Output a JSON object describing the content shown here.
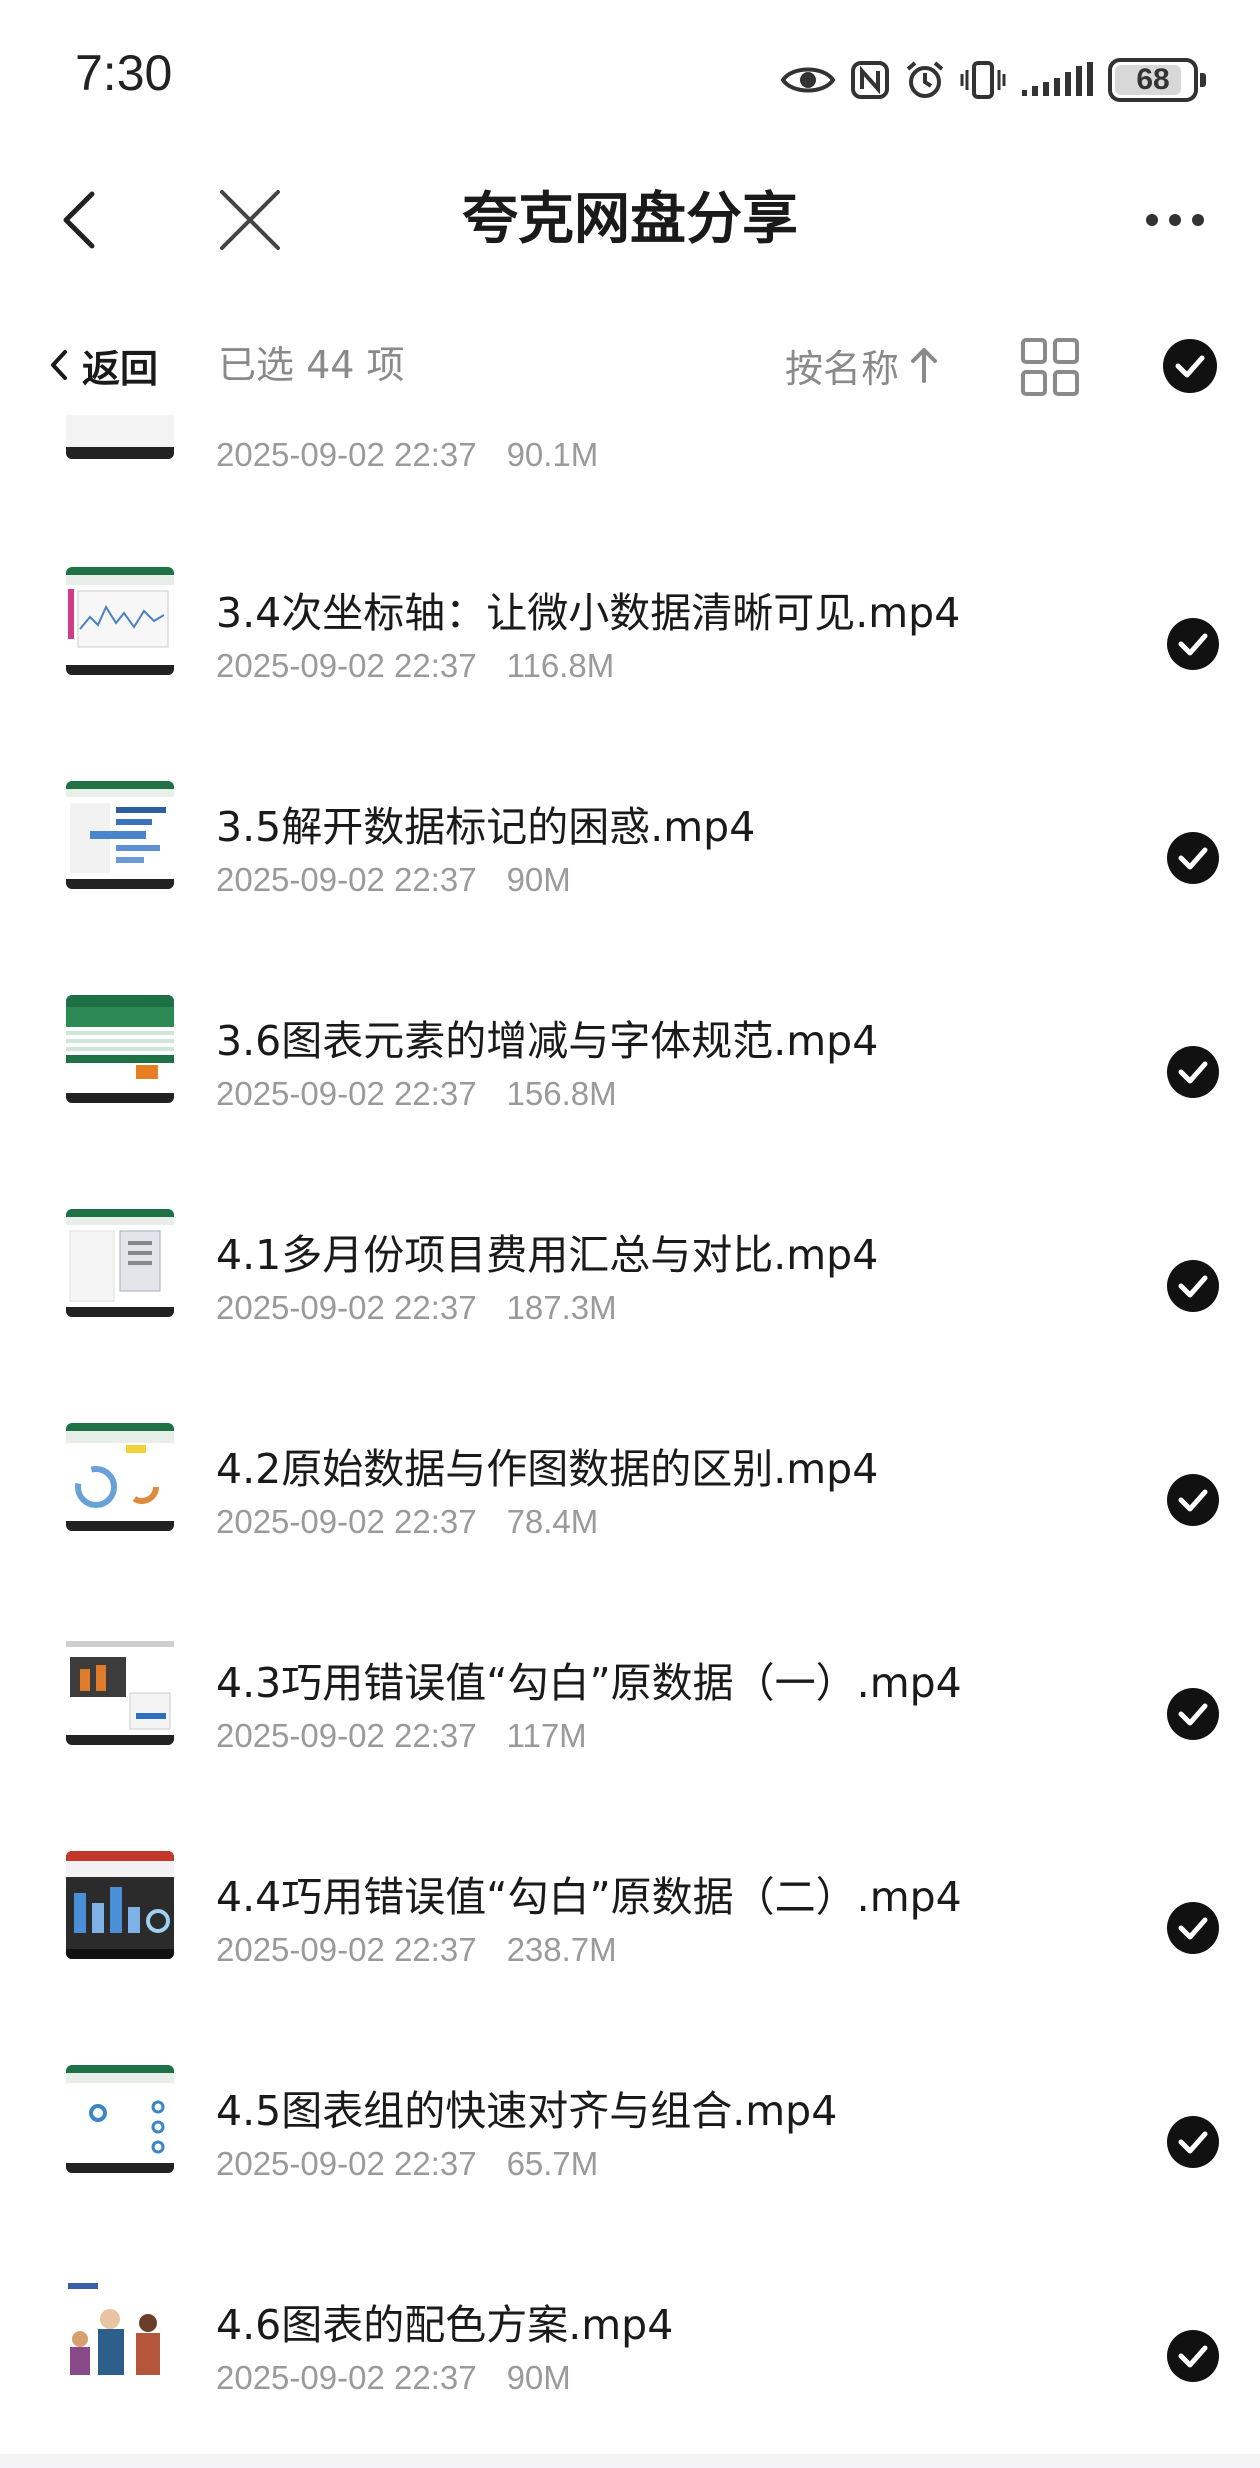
{
  "status_bar": {
    "time": "7:30",
    "battery": "68"
  },
  "header": {
    "title": "夸克网盘分享"
  },
  "toolbar": {
    "back_label": "返回",
    "selected_count": "已选 44 项",
    "sort_label": "按名称"
  },
  "partial_item": {
    "date": "2025-09-02 22:37",
    "size": "90.1M"
  },
  "files": [
    {
      "name": "3.4次坐标轴：让微小数据清晰可见.mp4",
      "date": "2025-09-02 22:37",
      "size": "116.8M",
      "thumb": "excel-line"
    },
    {
      "name": "3.5解开数据标记的困惑.mp4",
      "date": "2025-09-02 22:37",
      "size": "90M",
      "thumb": "excel-bar"
    },
    {
      "name": "3.6图表元素的增减与字体规范.mp4",
      "date": "2025-09-02 22:37",
      "size": "156.8M",
      "thumb": "excel-green"
    },
    {
      "name": "4.1多月份项目费用汇总与对比.mp4",
      "date": "2025-09-02 22:37",
      "size": "187.3M",
      "thumb": "excel-table"
    },
    {
      "name": "4.2原始数据与作图数据的区别.mp4",
      "date": "2025-09-02 22:37",
      "size": "78.4M",
      "thumb": "excel-donut"
    },
    {
      "name": "4.3巧用错误值“勾白”原数据（一）.mp4",
      "date": "2025-09-02 22:37",
      "size": "117M",
      "thumb": "excel-orange"
    },
    {
      "name": "4.4巧用错误值“勾白”原数据（二）.mp4",
      "date": "2025-09-02 22:37",
      "size": "238.7M",
      "thumb": "ppt-red"
    },
    {
      "name": "4.5图表组的快速对齐与组合.mp4",
      "date": "2025-09-02 22:37",
      "size": "65.7M",
      "thumb": "excel-circles"
    },
    {
      "name": "4.6图表的配色方案.mp4",
      "date": "2025-09-02 22:37",
      "size": "90M",
      "thumb": "illustration"
    }
  ]
}
